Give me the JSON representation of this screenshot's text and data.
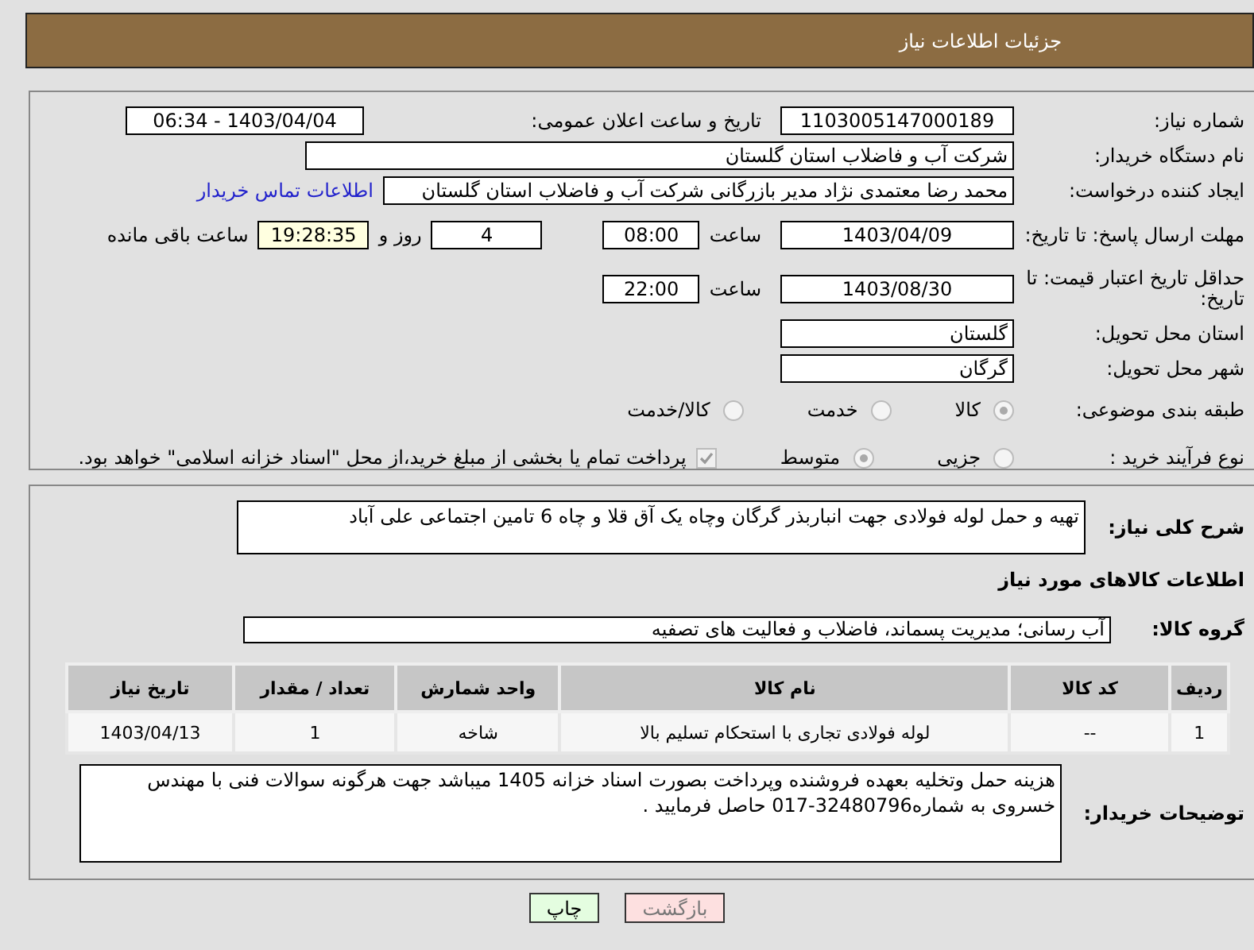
{
  "header": {
    "title": "جزئیات اطلاعات نیاز"
  },
  "need_number": {
    "label": "شماره نیاز:",
    "value": "1103005147000189"
  },
  "announce": {
    "label": "تاریخ و ساعت اعلان عمومی:",
    "value": "1403/04/04 - 06:34"
  },
  "buyer_org": {
    "label": "نام دستگاه خریدار:",
    "value": "شرکت آب و فاضلاب استان گلستان"
  },
  "requester": {
    "label": "ایجاد کننده درخواست:",
    "value": "محمد رضا معتمدی نژاد مدیر بازرگانی شرکت آب و فاضلاب استان گلستان",
    "link": "اطلاعات تماس خریدار"
  },
  "reply_deadline": {
    "label": "مهلت ارسال پاسخ: تا تاریخ:",
    "date": "1403/04/09",
    "time_label": "ساعت",
    "time": "08:00",
    "days": "4",
    "days_label": "روز و",
    "remaining": "19:28:35",
    "remaining_label": "ساعت باقی مانده"
  },
  "price_validity": {
    "label": "حداقل تاریخ اعتبار قیمت: تا تاریخ:",
    "date": "1403/08/30",
    "time_label": "ساعت",
    "time": "22:00"
  },
  "province": {
    "label": "استان محل تحویل:",
    "value": "گلستان"
  },
  "city": {
    "label": "شهر محل تحویل:",
    "value": "گرگان"
  },
  "category": {
    "label": "طبقه بندی موضوعی:",
    "options": [
      {
        "label": "کالا",
        "selected": true
      },
      {
        "label": "خدمت",
        "selected": false
      },
      {
        "label": "کالا/خدمت",
        "selected": false
      }
    ]
  },
  "process": {
    "label": "نوع فرآیند خرید :",
    "options": [
      {
        "label": "جزیی",
        "selected": false
      },
      {
        "label": "متوسط",
        "selected": true
      }
    ],
    "treasury": {
      "checked": true,
      "text": "پرداخت تمام یا بخشی از مبلغ خرید،از محل \"اسناد خزانه اسلامی\" خواهد بود."
    }
  },
  "description": {
    "label": "شرح کلی نیاز:",
    "value": "تهیه و حمل لوله فولادی جهت انباربذر گرگان وچاه یک آق قلا و چاه 6 تامین اجتماعی علی آباد"
  },
  "goods_title": "اطلاعات کالاهای مورد نیاز",
  "goods_group": {
    "label": "گروه کالا:",
    "value": "آب رسانی؛ مدیریت پسماند، فاضلاب و فعالیت های تصفیه"
  },
  "table": {
    "columns": [
      "ردیف",
      "کد کالا",
      "نام کالا",
      "واحد شمارش",
      "تعداد / مقدار",
      "تاریخ نیاز"
    ],
    "rows": [
      [
        "1",
        "--",
        "لوله فولادی تجاری با استحکام تسلیم بالا",
        "شاخه",
        "1",
        "1403/04/13"
      ]
    ]
  },
  "buyer_notes": {
    "label": "توضیحات خریدار:",
    "value": "هزینه حمل وتخلیه بعهده فروشنده وپرداخت بصورت اسناد خزانه 1405 میباشد جهت هرگونه سوالات فنی با مهندس خسروی به شماره32480796-017 حاصل فرمایید ."
  },
  "buttons": [
    {
      "label": "بازگشت",
      "kind": "back"
    },
    {
      "label": "چاپ",
      "kind": "print"
    }
  ]
}
